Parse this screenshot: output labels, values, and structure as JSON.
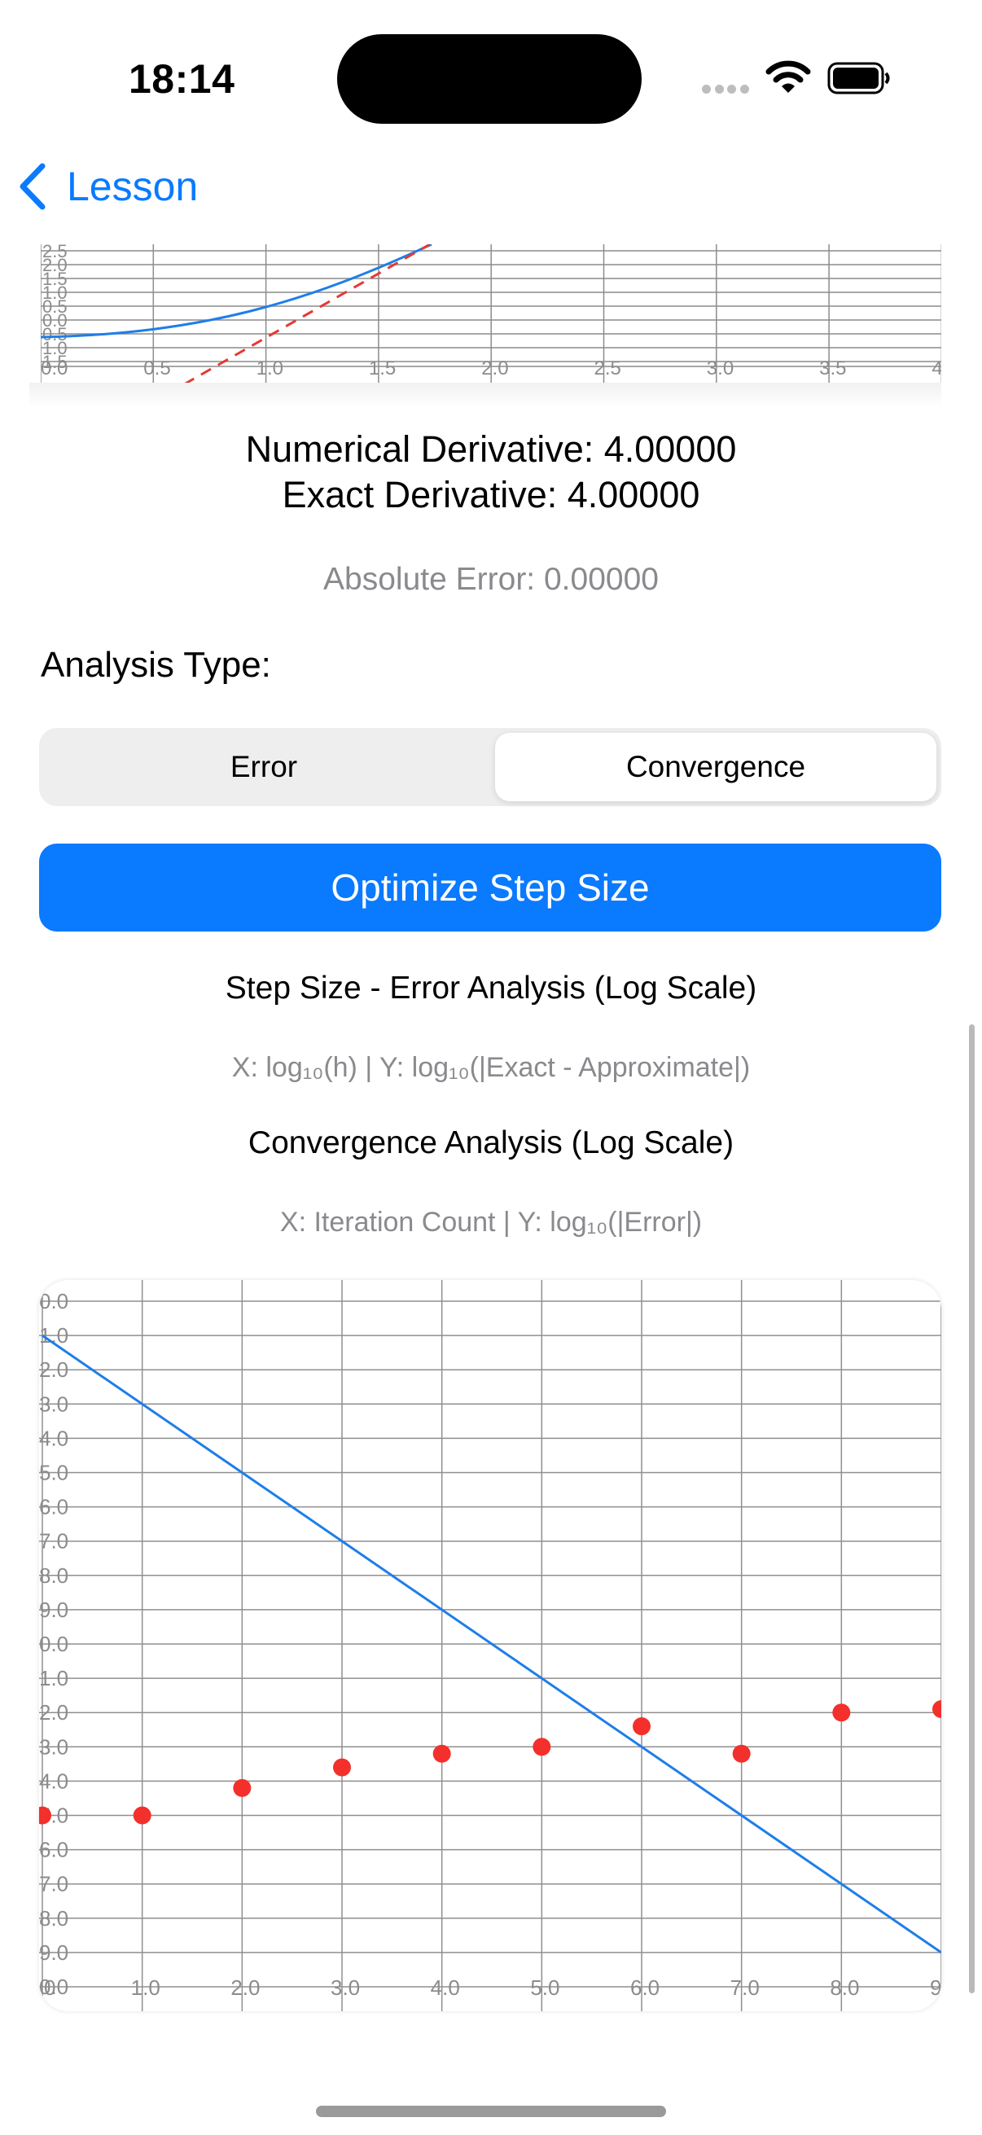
{
  "status_bar": {
    "time": "18:14"
  },
  "nav": {
    "back_label": "Lesson"
  },
  "top_chart": {
    "x_ticks": [
      "0.0",
      "0.5",
      "1.0",
      "1.5",
      "2.0",
      "2.5",
      "3.0",
      "3.5",
      "4."
    ],
    "y_ticks": [
      "2.5",
      "2.0",
      "1.5",
      "1.0",
      "0.5",
      "0.0",
      "0.5",
      "1.0",
      "1.5"
    ],
    "series_colors": {
      "function": "#1E7EE8",
      "tangent": "#E53935"
    }
  },
  "results": {
    "numerical": "Numerical Derivative: 4.00000",
    "exact": "Exact Derivative: 4.00000",
    "abs_error": "Absolute Error: 0.00000"
  },
  "analysis": {
    "label": "Analysis Type:",
    "options": [
      "Error",
      "Convergence"
    ],
    "selected": "Convergence"
  },
  "optimize_button": "Optimize Step Size",
  "step_chart": {
    "title": "Step Size - Error Analysis (Log Scale)",
    "subtitle": "X: log₁₀(h) | Y: log₁₀(|Exact - Approximate|)"
  },
  "convergence_chart": {
    "title": "Convergence Analysis (Log Scale)",
    "subtitle": "X: Iteration Count | Y: log₁₀(|Error|)"
  },
  "chart_data": {
    "type": "scatter",
    "title": "Convergence Analysis (Log Scale)",
    "xlabel": "X: Iteration Count",
    "ylabel": "Y: log₁₀(|Error|)",
    "x_tick_labels": [
      "0",
      "1.0",
      "2.0",
      "3.0",
      "4.0",
      "5.0",
      "6.0",
      "7.0",
      "8.0",
      "9."
    ],
    "y_tick_labels": [
      "0.0",
      "1.0",
      "2.0",
      "3.0",
      "4.0",
      "5.0",
      "6.0",
      "7.0",
      "8.0",
      "9.0",
      "0.0",
      "1.0",
      "2.0",
      "3.0",
      "4.0",
      "5.0",
      "6.0",
      "7.0",
      "8.0",
      "9.0",
      "0.0"
    ],
    "xlim": [
      0,
      9
    ],
    "ylim": [
      -20,
      0
    ],
    "grid": true,
    "series": [
      {
        "type": "line",
        "color": "#1E7EE8",
        "x": [
          0,
          9
        ],
        "y": [
          -1,
          -19
        ]
      },
      {
        "type": "scatter",
        "color": "#F3302B",
        "x": [
          0,
          1,
          2,
          3,
          4,
          5,
          6,
          7,
          8,
          9
        ],
        "y": [
          -15,
          -15,
          -14.2,
          -13.6,
          -13.2,
          -13,
          -12.4,
          -13.2,
          -12,
          -11.9
        ]
      }
    ]
  }
}
